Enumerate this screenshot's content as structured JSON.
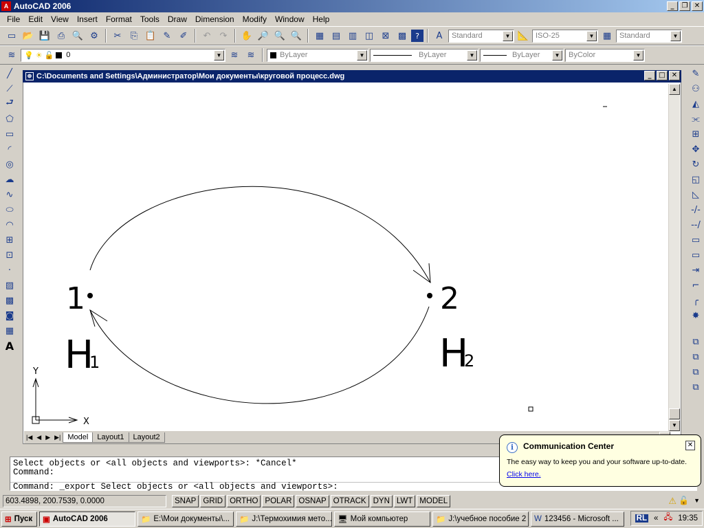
{
  "app": {
    "title": "AutoCAD 2006",
    "icon_label": "A"
  },
  "menu": [
    "File",
    "Edit",
    "View",
    "Insert",
    "Format",
    "Tools",
    "Draw",
    "Dimension",
    "Modify",
    "Window",
    "Help"
  ],
  "toolbar": {
    "text_style": "Standard",
    "dim_style": "ISO-25",
    "table_style": "Standard",
    "layer": "0",
    "color": "ByLayer",
    "linetype": "ByLayer",
    "lineweight": "ByLayer",
    "plotstyle": "ByColor"
  },
  "drawing": {
    "title": "C:\\Documents and Settings\\Администратор\\Мои документы\\круговой процесс.dwg",
    "point1_label": "1",
    "point2_label": "2",
    "h1_label": "H",
    "h1_sub": "1",
    "h2_label": "H",
    "h2_sub": "2",
    "ucs_x": "X",
    "ucs_y": "Y"
  },
  "tabs": [
    "Model",
    "Layout1",
    "Layout2"
  ],
  "command": {
    "line1": "Select objects or <all objects and viewports>: *Cancel*",
    "line2": "Command:",
    "line3": "Command: _export Select objects or <all objects and viewports>:"
  },
  "status": {
    "coords": "603.4898, 200.7539, 0.0000",
    "buttons": [
      "SNAP",
      "GRID",
      "ORTHO",
      "POLAR",
      "OSNAP",
      "OTRACK",
      "DYN",
      "LWT",
      "MODEL"
    ]
  },
  "balloon": {
    "title": "Communication Center",
    "text": "The easy way to keep you and your software up-to-date.",
    "link": "Click here."
  },
  "taskbar": {
    "start": "Пуск",
    "items": [
      "AutoCAD 2006",
      "E:\\Мои документы\\...",
      "J:\\Термохимия мето...",
      "Мой компьютер",
      "J:\\учебное пособие 2",
      "123456 - Microsoft ..."
    ],
    "lang": "RL",
    "time": "19:35"
  }
}
